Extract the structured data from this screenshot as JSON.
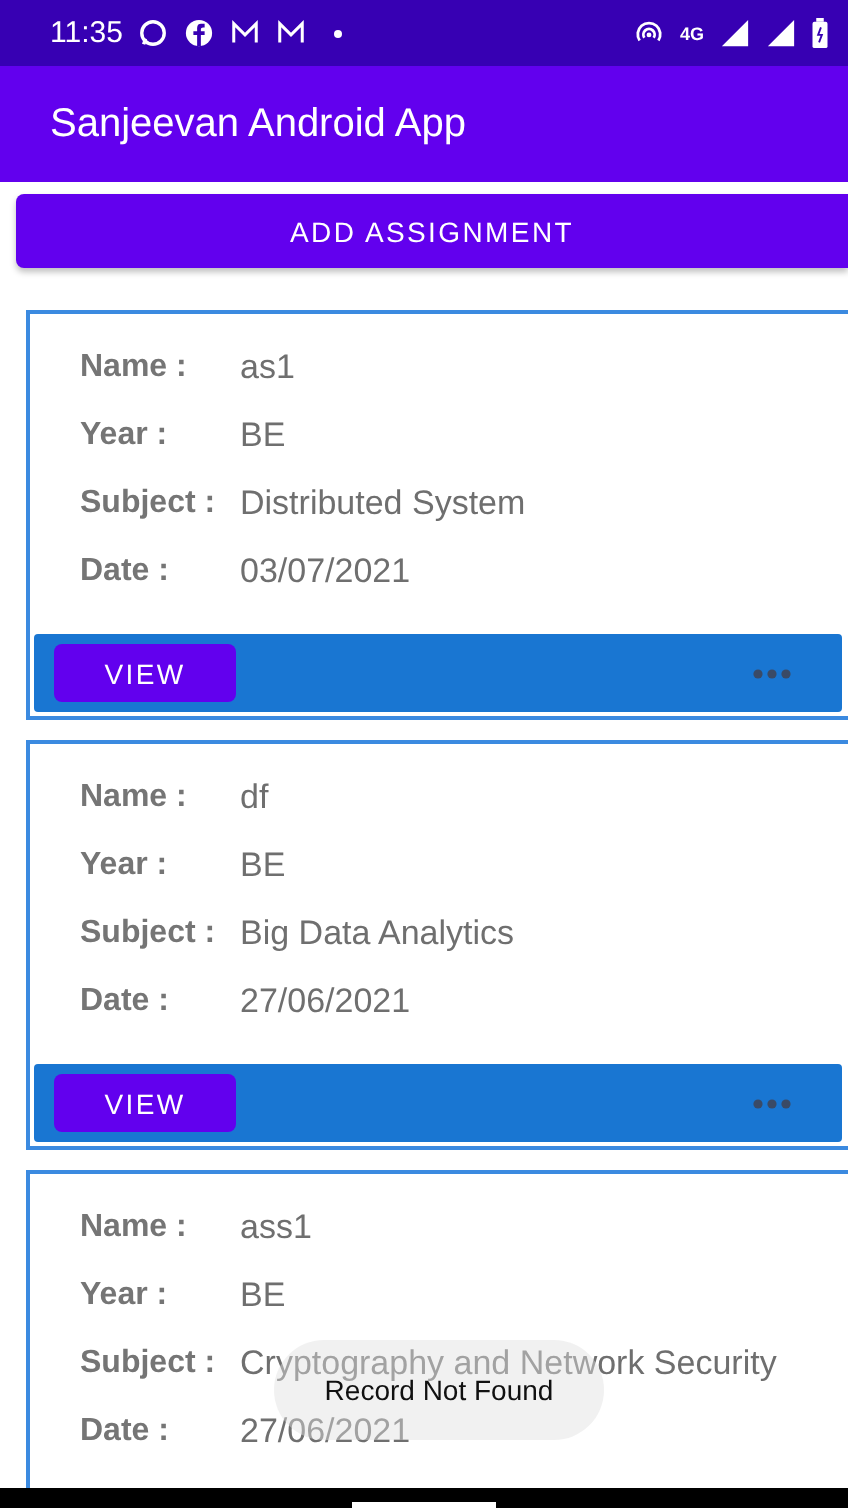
{
  "status_bar": {
    "time": "11:35",
    "network": "4G"
  },
  "app_bar": {
    "title": "Sanjeevan Android App"
  },
  "add_button": {
    "label": "ADD ASSIGNMENT"
  },
  "cards": [
    {
      "fields": [
        {
          "label": "Name :",
          "value": "as1"
        },
        {
          "label": "Year :",
          "value": "BE"
        },
        {
          "label": "Subject :",
          "value": "Distributed System"
        },
        {
          "label": "Date :",
          "value": "03/07/2021"
        }
      ],
      "view_button": "VIEW"
    },
    {
      "fields": [
        {
          "label": "Name :",
          "value": "df"
        },
        {
          "label": "Year :",
          "value": "BE"
        },
        {
          "label": "Subject :",
          "value": "Big Data Analytics"
        },
        {
          "label": "Date :",
          "value": "27/06/2021"
        }
      ],
      "view_button": "VIEW"
    },
    {
      "fields": [
        {
          "label": "Name :",
          "value": "ass1"
        },
        {
          "label": "Year :",
          "value": "BE"
        },
        {
          "label": "Subject :",
          "value": "Cryptography and Network Security"
        },
        {
          "label": "Date :",
          "value": "27/06/2021"
        }
      ]
    }
  ],
  "toast": {
    "message": "Record Not Found"
  }
}
